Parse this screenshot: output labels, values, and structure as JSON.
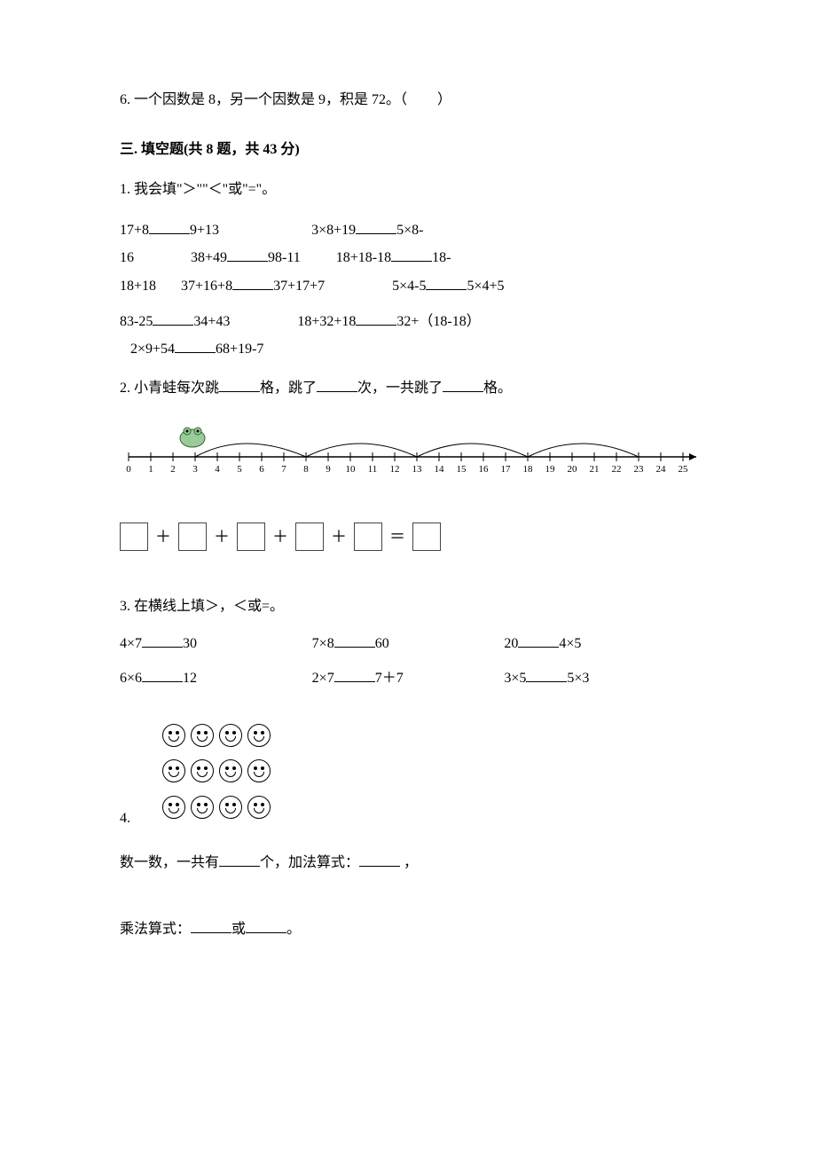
{
  "q6": {
    "text_pre": "6. 一个因数是 8，另一个因数是 9，积是 72。（",
    "text_post": "）"
  },
  "section3": {
    "title": "三. 填空题(共 8 题，共 43 分)"
  },
  "s3q1": {
    "intro": "1. 我会填\"＞\"\"＜\"或\"=\"。",
    "rowA_1a": "17+8",
    "rowA_1b": "9+13",
    "rowA_2a": "3×8+19",
    "rowA_2b": "5×8-",
    "rowB_1": "16",
    "rowB_2a": "38+49",
    "rowB_2b": "98-11",
    "rowB_3a": "18+18-18",
    "rowB_3b": "18-",
    "rowC_1": "18+18",
    "rowC_2a": "37+16+8",
    "rowC_2b": "37+17+7",
    "rowC_3a": "5×4-5",
    "rowC_3b": "5×4+5",
    "rowD_1a": "83-25",
    "rowD_1b": "34+43",
    "rowD_2a": "18+32+18",
    "rowD_2b": "32+（18-18）",
    "rowE_1a": "2×9+54",
    "rowE_1b": "68+19-7"
  },
  "s3q2": {
    "text_a": "2. 小青蛙每次跳",
    "text_b": "格，跳了",
    "text_c": "次，一共跳了",
    "text_d": "格。"
  },
  "numline": {
    "ticks": [
      "0",
      "1",
      "2",
      "3",
      "4",
      "5",
      "6",
      "7",
      "8",
      "9",
      "10",
      "11",
      "12",
      "13",
      "14",
      "15",
      "16",
      "17",
      "18",
      "19",
      "20",
      "21",
      "22",
      "23",
      "24",
      "25"
    ]
  },
  "boxes": {
    "plus": "＋",
    "eq": "＝"
  },
  "s3q3": {
    "intro": "3. 在横线上填＞，＜或=。",
    "r1c1a": "4×7",
    "r1c1b": "30",
    "r1c2a": "7×8",
    "r1c2b": "60",
    "r1c3a": "20",
    "r1c3b": "4×5",
    "r2c1a": "6×6",
    "r2c1b": "12",
    "r2c2a": "2×7",
    "r2c2b": "7＋7",
    "r2c3a": "3×5",
    "r2c3b": "5×3"
  },
  "s3q4": {
    "label": "4.",
    "count_a": "数一数，一共有",
    "count_b": "个，加法算式：",
    "count_c": "，",
    "mul_a": "乘法算式：",
    "mul_b": "或",
    "mul_c": "。"
  }
}
